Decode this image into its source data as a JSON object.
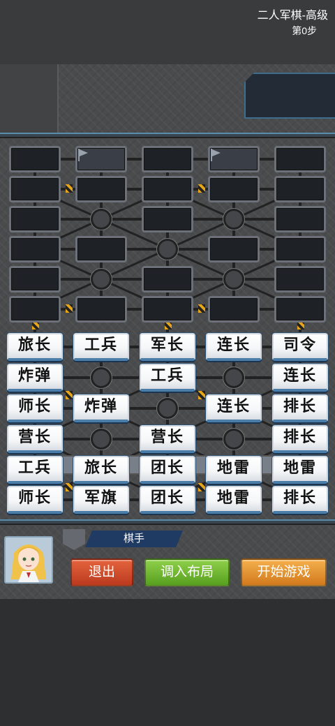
{
  "game": {
    "title": "二人军棋-高级",
    "step": "第0步"
  },
  "opponent_rows": [
    [
      "",
      "flag",
      "",
      "flag",
      ""
    ],
    [
      "",
      "",
      "",
      "",
      ""
    ],
    [
      "",
      "camp",
      "",
      "camp",
      ""
    ],
    [
      "",
      "",
      "camp",
      "",
      ""
    ],
    [
      "",
      "camp",
      "",
      "camp",
      ""
    ],
    [
      "",
      "",
      "",
      "",
      ""
    ]
  ],
  "player_rows": [
    [
      "旅长",
      "工兵",
      "军长",
      "连长",
      "司令"
    ],
    [
      "炸弹",
      "",
      "工兵",
      "",
      "连长"
    ],
    [
      "师长",
      "炸弹",
      "",
      "连长",
      "排长"
    ],
    [
      "营长",
      "",
      "营长",
      "",
      "排长"
    ],
    [
      "工兵",
      "旅长",
      "团长",
      "地雷",
      "地雷"
    ],
    [
      "师长",
      "军旗",
      "团长",
      "地雷",
      "排长"
    ]
  ],
  "player": {
    "name": "棋手",
    "avatar": "anime-girl-avatar"
  },
  "buttons": {
    "exit": "退出",
    "load_layout": "调入布局",
    "start": "开始游戏"
  },
  "colors": {
    "exit": "#d04e2c",
    "load_layout": "#6fb531",
    "start": "#e79a34",
    "piece_accent": "#4a7da8"
  }
}
